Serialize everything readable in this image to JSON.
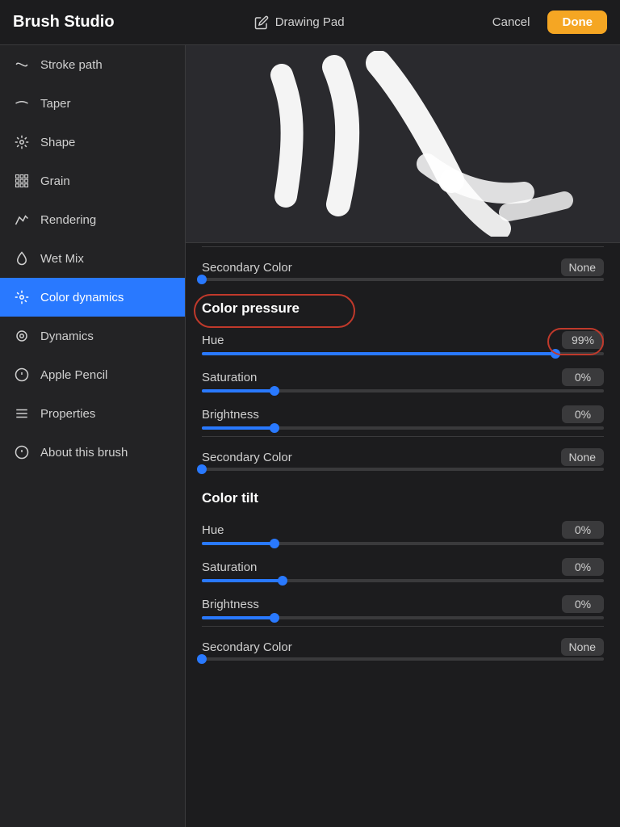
{
  "app": {
    "title": "Brush Studio",
    "drawing_pad_label": "Drawing Pad",
    "cancel_label": "Cancel",
    "done_label": "Done"
  },
  "sidebar": {
    "items": [
      {
        "id": "stroke-path",
        "label": "Stroke path",
        "icon": "↩"
      },
      {
        "id": "taper",
        "label": "Taper",
        "icon": "〜"
      },
      {
        "id": "shape",
        "label": "Shape",
        "icon": "✳"
      },
      {
        "id": "grain",
        "label": "Grain",
        "icon": "⁂"
      },
      {
        "id": "rendering",
        "label": "Rendering",
        "icon": "⟋"
      },
      {
        "id": "wet-mix",
        "label": "Wet Mix",
        "icon": "💧"
      },
      {
        "id": "color-dynamics",
        "label": "Color dynamics",
        "icon": "✳",
        "active": true
      },
      {
        "id": "dynamics",
        "label": "Dynamics",
        "icon": "◎"
      },
      {
        "id": "apple-pencil",
        "label": "Apple Pencil",
        "icon": "ℹ"
      },
      {
        "id": "properties",
        "label": "Properties",
        "icon": "☰"
      },
      {
        "id": "about",
        "label": "About this brush",
        "icon": "ℹ"
      }
    ]
  },
  "content": {
    "top_secondary_color": {
      "label": "Secondary Color",
      "value": "None"
    },
    "color_pressure": {
      "title": "Color pressure",
      "hue": {
        "label": "Hue",
        "value": "99%",
        "fill_pct": 88
      },
      "saturation": {
        "label": "Saturation",
        "value": "0%",
        "fill_pct": 18
      },
      "brightness": {
        "label": "Brightness",
        "value": "0%",
        "fill_pct": 18
      },
      "secondary_color": {
        "label": "Secondary Color",
        "value": "None",
        "fill_pct": 0
      }
    },
    "color_tilt": {
      "title": "Color tilt",
      "hue": {
        "label": "Hue",
        "value": "0%",
        "fill_pct": 18
      },
      "saturation": {
        "label": "Saturation",
        "value": "0%",
        "fill_pct": 20
      },
      "brightness": {
        "label": "Brightness",
        "value": "0%",
        "fill_pct": 18
      },
      "secondary_color": {
        "label": "Secondary Color",
        "value": "None",
        "fill_pct": 0
      }
    }
  }
}
